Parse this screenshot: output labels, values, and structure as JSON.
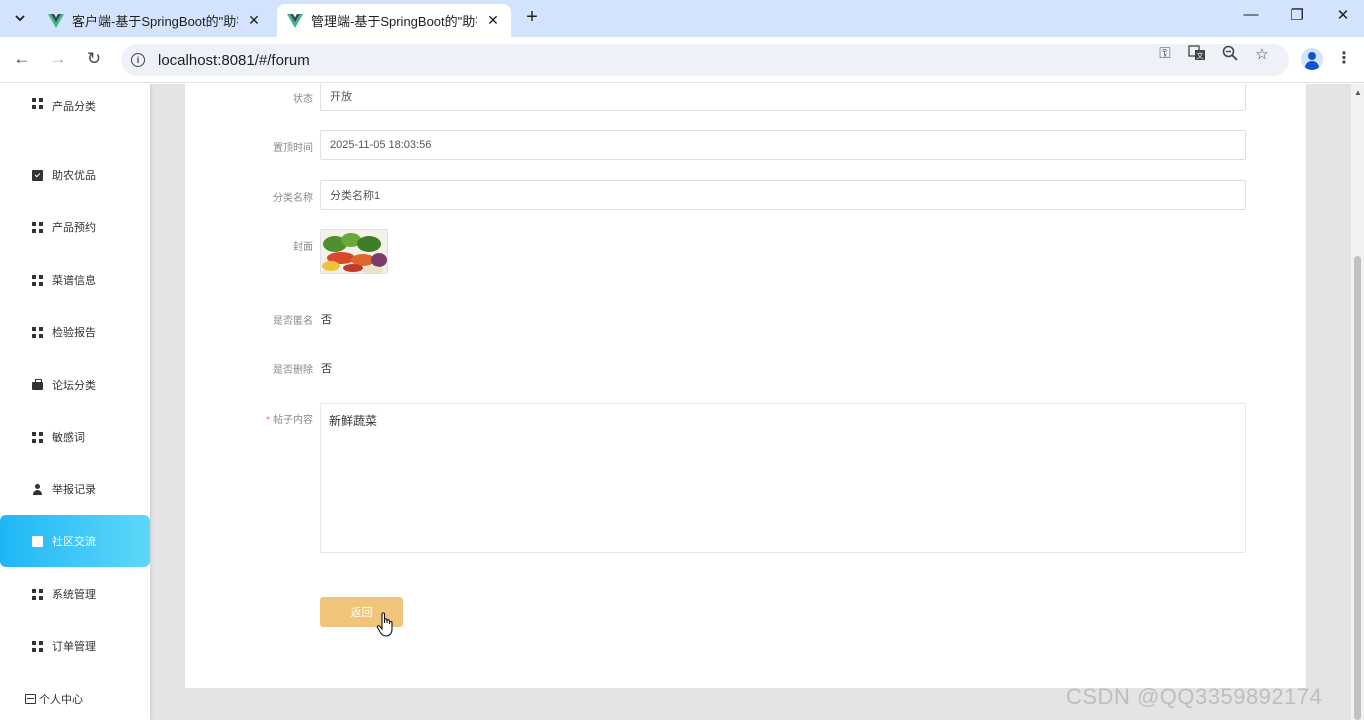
{
  "browser": {
    "tabs": [
      {
        "title": "客户端-基于SpringBoot的\"助农",
        "active": false
      },
      {
        "title": "管理端-基于SpringBoot的\"助农",
        "active": true
      }
    ],
    "url": "localhost:8081/#/forum"
  },
  "sidebar": {
    "items": [
      {
        "label": "产品分类",
        "icon": "grid-icon"
      },
      {
        "label": "助农优品",
        "icon": "clipboard-check-icon"
      },
      {
        "label": "产品预约",
        "icon": "grid-icon"
      },
      {
        "label": "菜谱信息",
        "icon": "grid-icon"
      },
      {
        "label": "检验报告",
        "icon": "grid-icon"
      },
      {
        "label": "论坛分类",
        "icon": "briefcase-icon"
      },
      {
        "label": "敏感词",
        "icon": "grid-icon"
      },
      {
        "label": "举报记录",
        "icon": "user-icon"
      },
      {
        "label": "社区交流",
        "icon": "document-icon",
        "active": true
      },
      {
        "label": "系统管理",
        "icon": "grid-icon"
      },
      {
        "label": "订单管理",
        "icon": "grid-icon"
      }
    ],
    "personal_center": "个人中心"
  },
  "form": {
    "status": {
      "label": "状态",
      "value": "开放"
    },
    "top_time": {
      "label": "置顶时间",
      "value": "2025-11-05 18:03:56"
    },
    "category": {
      "label": "分类名称",
      "value": "分类名称1"
    },
    "cover": {
      "label": "封面"
    },
    "anonymous": {
      "label": "是否匿名",
      "value": "否"
    },
    "deleted": {
      "label": "是否删除",
      "value": "否"
    },
    "content": {
      "label": "帖子内容",
      "required_mark": "*",
      "value": "新鲜蔬菜"
    },
    "back_button": "返回"
  },
  "watermark": "CSDN @QQ3359892174",
  "colors": {
    "accent": "#1fb6f6",
    "back_button": "#f0c47a",
    "tab_strip": "#d3e3fd"
  }
}
